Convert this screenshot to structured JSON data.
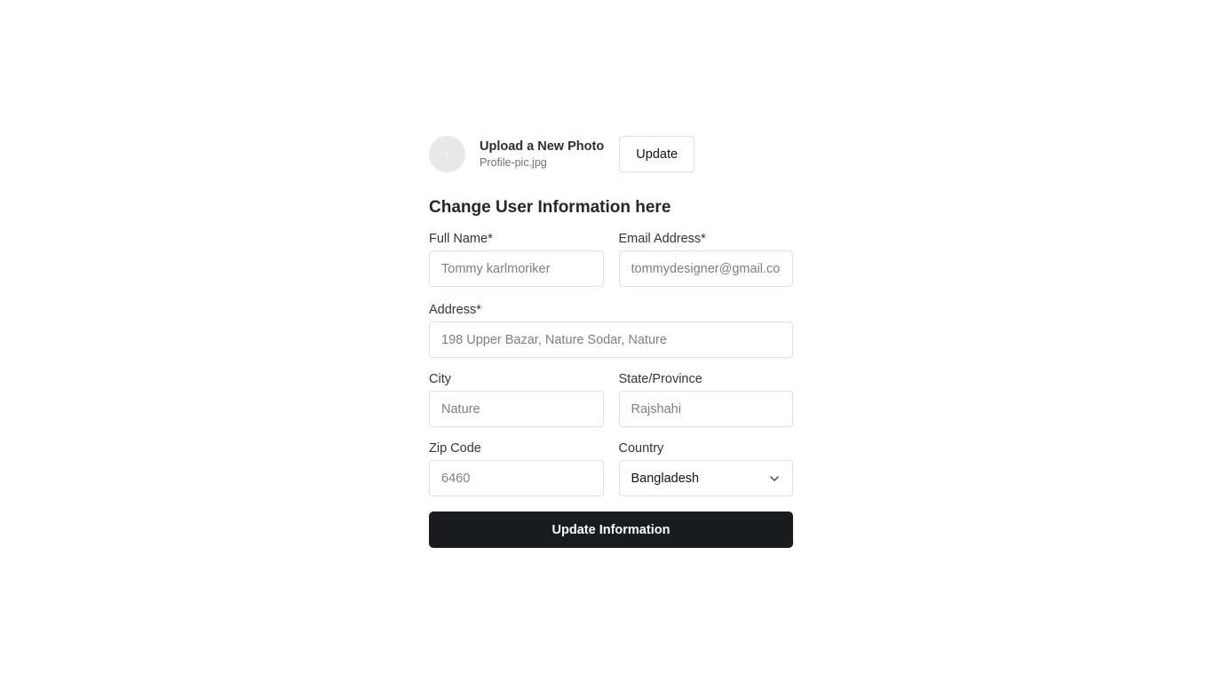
{
  "photo": {
    "title": "Upload a New Photo",
    "filename": "Profile-pic.jpg",
    "button_label": "Update"
  },
  "form": {
    "heading": "Change User Information here",
    "full_name": {
      "label": "Full Name*",
      "placeholder": "Tommy karlmoriker"
    },
    "email": {
      "label": "Email Address*",
      "placeholder": "tommydesigner@gmail.com"
    },
    "address": {
      "label": "Address*",
      "placeholder": "198 Upper Bazar, Nature Sodar, Nature"
    },
    "city": {
      "label": "City",
      "placeholder": "Nature"
    },
    "state": {
      "label": "State/Province",
      "placeholder": "Rajshahi"
    },
    "zip": {
      "label": "Zip Code",
      "placeholder": "6460"
    },
    "country": {
      "label": "Country",
      "value": "Bangladesh"
    },
    "submit_label": "Update Information"
  },
  "icons": {
    "country_dropdown": "chevron-down-icon"
  }
}
